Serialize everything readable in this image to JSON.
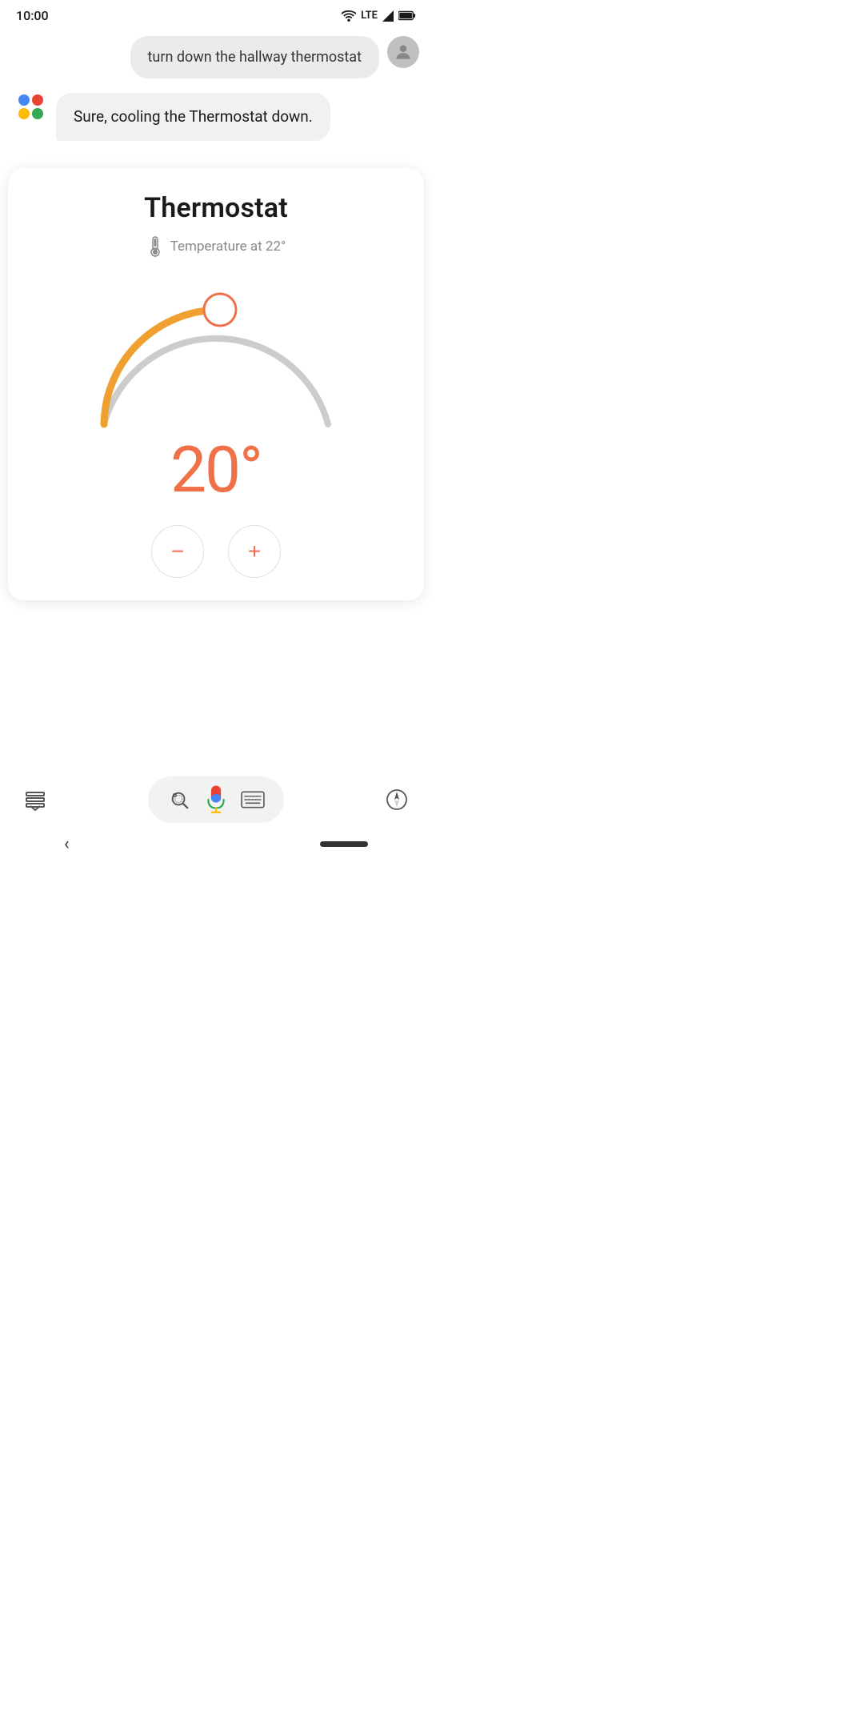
{
  "statusBar": {
    "time": "10:00",
    "lte": "LTE"
  },
  "userMessage": {
    "text": "turn down the hallway thermostat"
  },
  "assistantResponse": {
    "text": "Sure, cooling the Thermostat down."
  },
  "thermostatCard": {
    "title": "Thermostat",
    "temperatureLabel": "Temperature at 22°",
    "currentTemp": "20°",
    "minusLabel": "−",
    "plusLabel": "+"
  },
  "bottomBar": {
    "lensSrLabel": "lens-icon",
    "micSrLabel": "mic-icon",
    "keyboardSrLabel": "keyboard-icon",
    "compassSrLabel": "compass-icon",
    "assistantSrLabel": "assistant-icon"
  },
  "colors": {
    "arcActive": "#F0A030",
    "arcInactive": "#cccccc",
    "dialHandle": "#F07048",
    "tempText": "#F07048"
  }
}
